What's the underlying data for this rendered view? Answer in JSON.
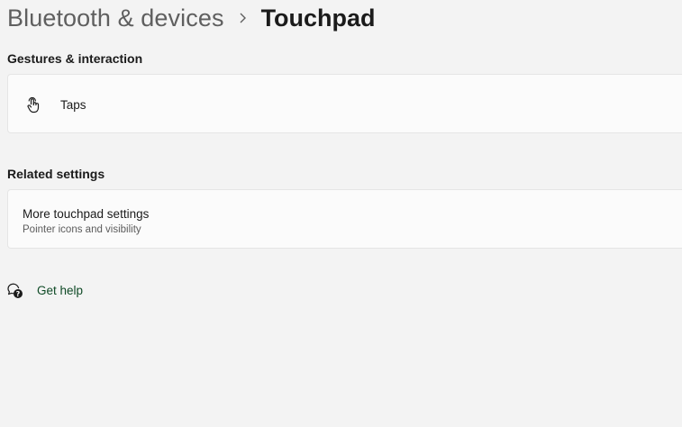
{
  "breadcrumb": {
    "parent": "Bluetooth & devices",
    "current": "Touchpad",
    "separator_icon": "chevron-right-icon"
  },
  "sections": {
    "gestures": {
      "heading": "Gestures & interaction",
      "taps": {
        "label": "Taps",
        "icon": "touch-tap-icon"
      }
    },
    "related": {
      "heading": "Related settings",
      "more_touchpad": {
        "label": "More touchpad settings",
        "description": "Pointer icons and visibility"
      }
    }
  },
  "help": {
    "label": "Get help",
    "icon": "help-chat-icon"
  },
  "colors": {
    "background": "#f3f3f3",
    "card": "#fbfbfb",
    "card_border": "#e5e5e5",
    "link": "#0f4a26"
  }
}
